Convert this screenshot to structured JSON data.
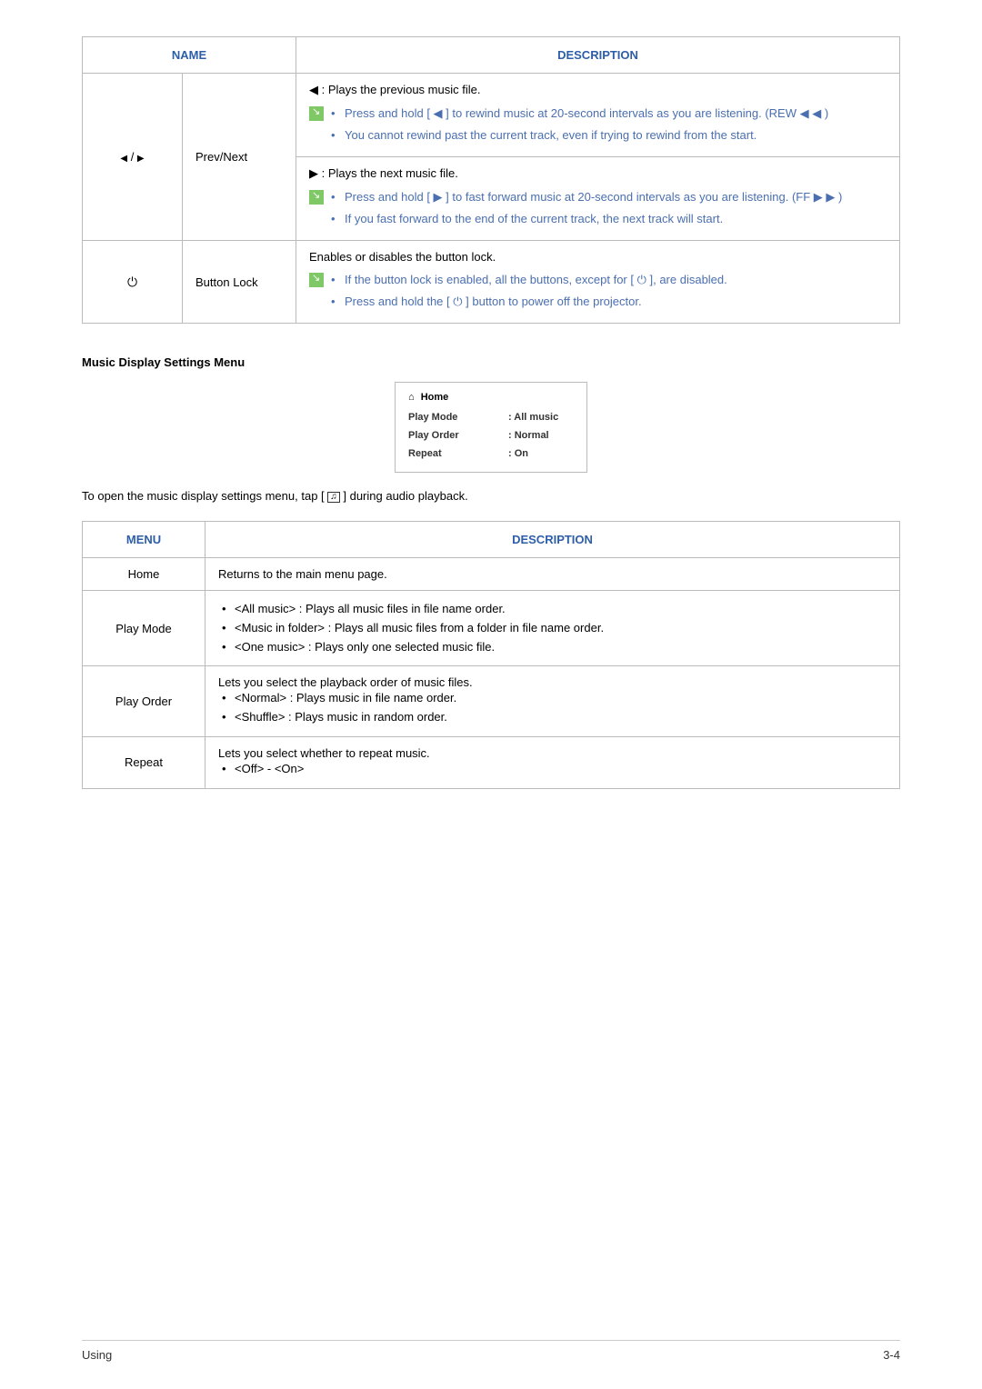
{
  "table1": {
    "headers": {
      "name": "NAME",
      "description": "DESCRIPTION"
    },
    "row1": {
      "icon_left": "◀",
      "icon_sep": " / ",
      "icon_right": "▶",
      "name": "Prev/Next",
      "prev": {
        "title": "◀ : Plays the previous music file.",
        "bullets": [
          "Press and hold [ ◀ ] to rewind music at 20-second intervals as you are listening. (REW ◀ ◀ )",
          "You cannot rewind past the current track, even if trying to rewind from the start."
        ]
      },
      "next": {
        "title": "▶ : Plays the next music file.",
        "bullets": [
          "Press and hold [ ▶ ] to fast forward music at 20-second intervals as you are listening. (FF ▶ ▶ )",
          "If you fast forward to the end of the current track, the next track will start."
        ]
      }
    },
    "row2": {
      "name": "Button Lock",
      "title": "Enables or disables the button lock.",
      "bullets": [
        "If the button lock is enabled, all the buttons, except for [ ⏻ ], are disabled.",
        "Press and hold the [ ⏻ ] button to power off the projector."
      ]
    }
  },
  "sectionTitle": "Music Display Settings Menu",
  "settingsBox": {
    "home": "Home",
    "rows": [
      {
        "k": "Play Mode",
        "v": ": All music"
      },
      {
        "k": "Play Order",
        "v": ": Normal"
      },
      {
        "k": "Repeat",
        "v": ": On"
      }
    ]
  },
  "openNote": {
    "before": "To open the music display settings menu, tap [ ",
    "after": " ] during audio playback."
  },
  "table2": {
    "headers": {
      "menu": "MENU",
      "description": "DESCRIPTION"
    },
    "rows": {
      "home": {
        "menu": "Home",
        "desc": "Returns to the main menu page."
      },
      "playMode": {
        "menu": "Play Mode",
        "bullets": [
          "<All music> : Plays all music files in file name order.",
          "<Music in folder> : Plays all music files from a folder in file name order.",
          "<One music> : Plays only one selected music file."
        ]
      },
      "playOrder": {
        "menu": "Play Order",
        "lead": "Lets you select the playback order of music files.",
        "bullets": [
          "<Normal> : Plays music in file name order.",
          "<Shuffle> : Plays music in random order."
        ]
      },
      "repeat": {
        "menu": "Repeat",
        "lead": "Lets you select whether to repeat music.",
        "bullets": [
          "<Off> - <On>"
        ]
      }
    }
  },
  "footer": {
    "left": "Using",
    "right": "3-4"
  }
}
